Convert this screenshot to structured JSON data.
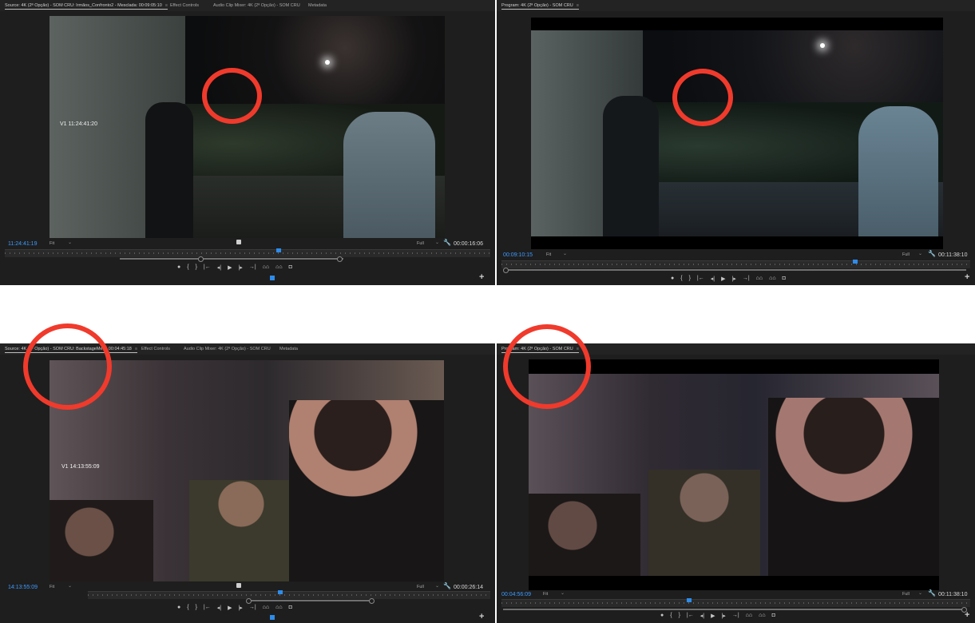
{
  "top_left": {
    "tabs": [
      "Source: 4K (2ª Opção) - SOM CRU: Irmãos_Confronto2 - Mesclada: 00:09:05:10",
      "Effect Controls",
      "Audio Clip Mixer: 4K (2ª Opção) - SOM CRU",
      "Metadata"
    ],
    "overlay": "V1 11:24:41:20",
    "timecode_left": "11:24:41:19",
    "fit": "Fit",
    "full": "Full",
    "timecode_right": "00:00:16:06"
  },
  "top_right": {
    "tabs": [
      "Program: 4K (2ª Opção) - SOM CRU"
    ],
    "timecode_left": "00:09:10:15",
    "fit": "Fit",
    "full": "Full",
    "timecode_right": "00:11:38:10"
  },
  "bottom_left": {
    "tabs": [
      "Source: 4K (2ª Opção) - SOM CRU: BackstageMelo: 00:04:45:18",
      "Effect Controls",
      "Audio Clip Mixer: 4K (2ª Opção) - SOM CRU",
      "Metadata"
    ],
    "overlay": "V1 14:13:55:09",
    "timecode_left": "14:13:55:09",
    "fit": "Fit",
    "full": "Full",
    "timecode_right": "00:00:26:14"
  },
  "bottom_right": {
    "tabs": [
      "Program: 4K (2ª Opção) - SOM CRU"
    ],
    "timecode_left": "00:04:56:09",
    "fit": "Fit",
    "full": "Full",
    "timecode_right": "00:11:38:10"
  },
  "icons": {
    "marker": "●",
    "in": "{",
    "out": "}",
    "go_in": "|←",
    "step_back": "◂|",
    "play": "▶",
    "step_fwd": "|▸",
    "go_out": "→|",
    "insert": "⌂⌂",
    "overwrite": "⌂⌂",
    "camera": "◘",
    "wrench": "🔧",
    "plus": "+",
    "menu": "≡"
  },
  "colors": {
    "timecode_blue": "#3d9bff",
    "highlight_red": "#f03a2c",
    "playhead_blue": "#2d8ceb"
  }
}
